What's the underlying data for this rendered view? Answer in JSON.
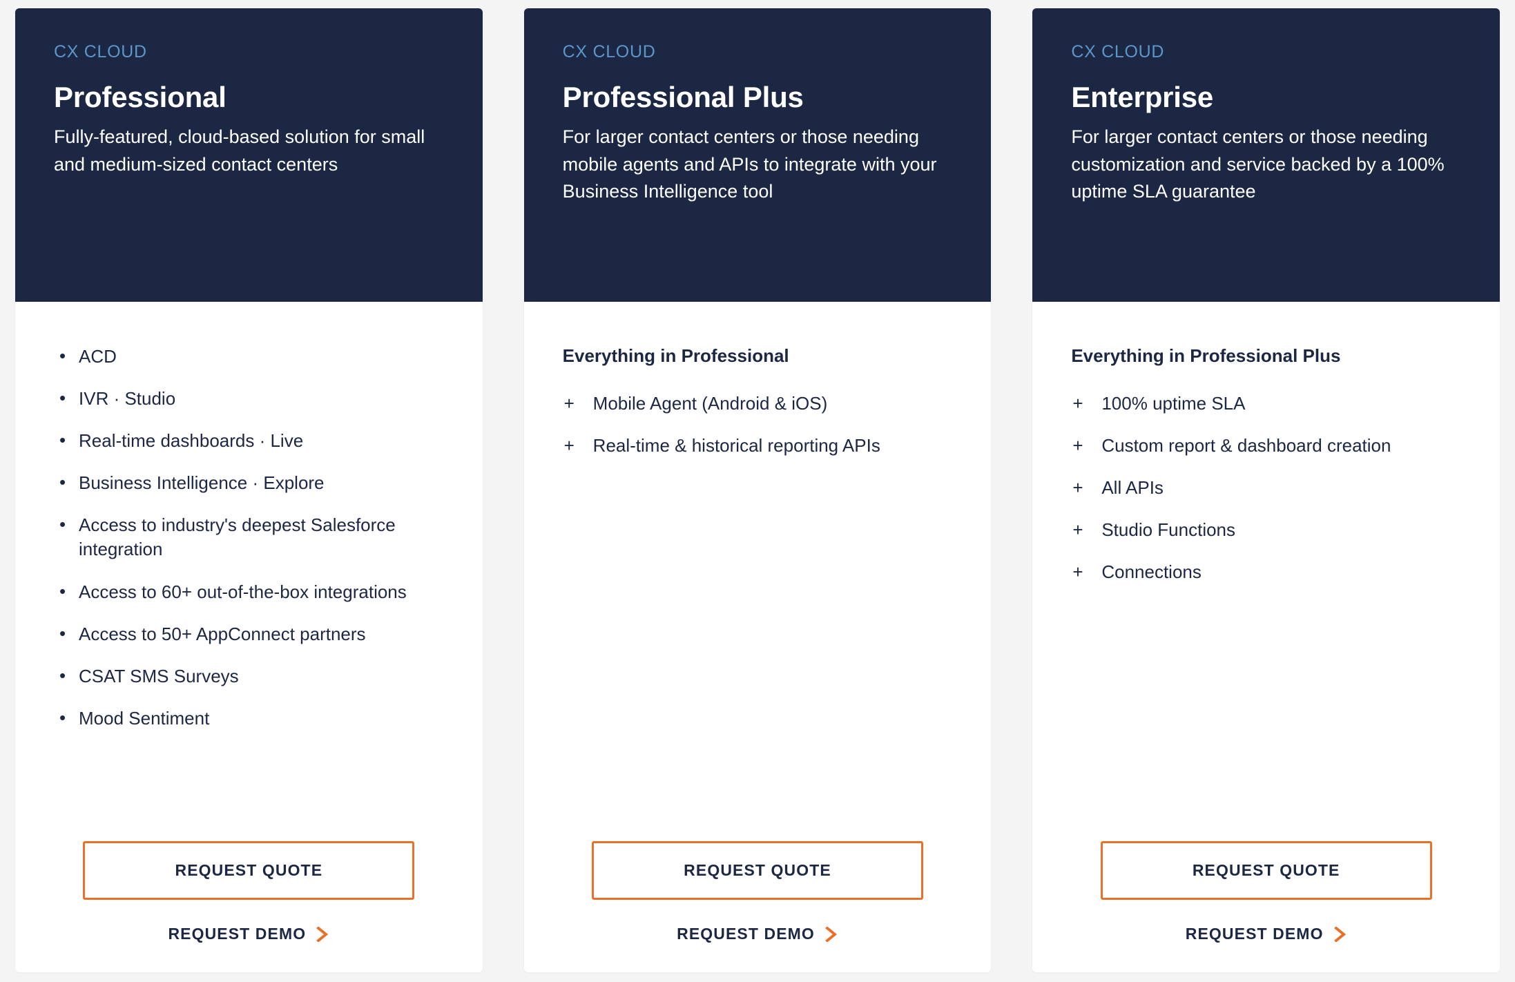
{
  "background_color": "#f4f4f4",
  "theme": {
    "header_navy": "#1c2744",
    "eyebrow_blue": "#5b96cb",
    "accent_orange": "#e8712a",
    "body_text": "#1c2744",
    "card_background": "#ffffff"
  },
  "cards": [
    {
      "eyebrow": "CX CLOUD",
      "name": "Professional",
      "description": "Fully-featured, cloud-based solution for small and medium-sized contact centers",
      "list_style": "bulleted",
      "includes_heading": "",
      "features": [
        "ACD",
        "IVR · Studio",
        "Real-time dashboards · Live",
        "Business Intelligence · Explore",
        "Access to industry's deepest Salesforce integration",
        "Access to 60+ out-of-the-box integrations",
        "Access to 50+ AppConnect partners",
        "CSAT SMS Surveys",
        "Mood Sentiment"
      ],
      "quote_label": "REQUEST QUOTE",
      "demo_label": "REQUEST DEMO"
    },
    {
      "eyebrow": "CX CLOUD",
      "name": "Professional Plus",
      "description": "For larger contact centers or those needing mobile agents and APIs to integrate with your Business Intelligence tool",
      "list_style": "plussed",
      "includes_heading": "Everything in Professional",
      "features": [
        "Mobile Agent (Android & iOS)",
        "Real-time & historical reporting APIs"
      ],
      "quote_label": "REQUEST QUOTE",
      "demo_label": "REQUEST DEMO"
    },
    {
      "eyebrow": "CX CLOUD",
      "name": "Enterprise",
      "description": "For larger contact centers or those needing customization and service backed by a 100% uptime SLA guarantee",
      "list_style": "plussed",
      "includes_heading": "Everything in Professional Plus",
      "features": [
        "100% uptime SLA",
        "Custom report & dashboard creation",
        "All APIs",
        "Studio Functions",
        "Connections"
      ],
      "quote_label": "REQUEST QUOTE",
      "demo_label": "REQUEST DEMO"
    }
  ],
  "icons": {
    "plus_marker": "+",
    "chevron_right": "chevron-right-icon"
  }
}
